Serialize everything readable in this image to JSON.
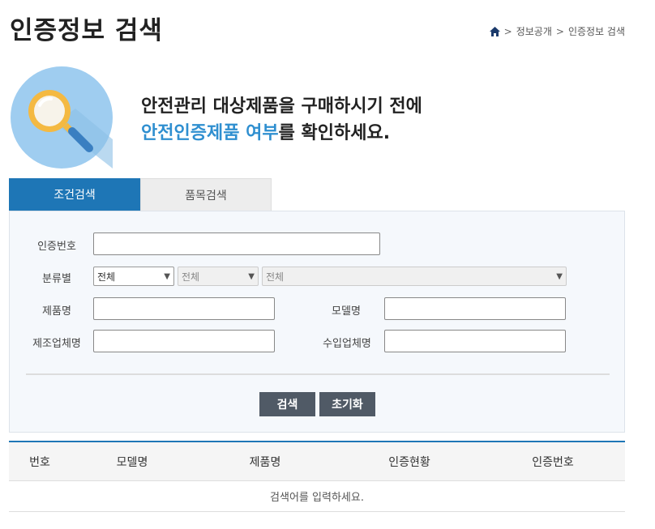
{
  "header": {
    "title": "인증정보 검색",
    "breadcrumb": [
      "정보공개",
      "인증정보 검색"
    ],
    "breadcrumb_sep": ">"
  },
  "hero": {
    "line1": "안전관리 대상제품을 구매하시기 전에",
    "line2_accent": "안전인증제품 여부",
    "line2_rest": "를 확인하세요."
  },
  "tabs": [
    {
      "label": "조건검색",
      "active": true
    },
    {
      "label": "품목검색",
      "active": false
    }
  ],
  "form": {
    "cert_number_label": "인증번호",
    "cert_number_value": "",
    "category_label": "분류별",
    "category_selects": [
      "전체",
      "전체",
      "전체"
    ],
    "product_name_label": "제품명",
    "product_name_value": "",
    "model_name_label": "모델명",
    "model_name_value": "",
    "manufacturer_label": "제조업체명",
    "manufacturer_value": "",
    "importer_label": "수입업체명",
    "importer_value": "",
    "search_button": "검색",
    "reset_button": "초기화"
  },
  "results": {
    "columns": [
      "번호",
      "모델명",
      "제품명",
      "인증현황",
      "인증번호"
    ],
    "empty_message": "검색어를 입력하세요."
  },
  "colors": {
    "accent": "#1e76b6",
    "accent_text": "#2f8fd0",
    "button": "#505a66"
  }
}
